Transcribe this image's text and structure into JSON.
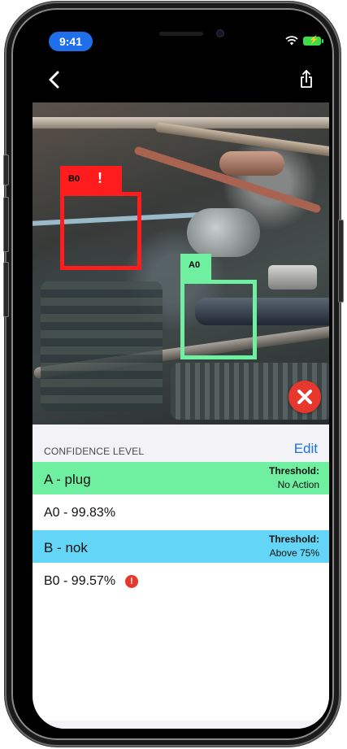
{
  "status_bar": {
    "time": "9:41"
  },
  "detections": [
    {
      "label": "B0",
      "alert": "!",
      "color": "#ff1c1c"
    },
    {
      "label": "A0",
      "color": "#6ef0a0"
    }
  ],
  "confidence": {
    "section_title": "CONFIDENCE LEVEL",
    "edit_label": "Edit",
    "groups": [
      {
        "name": "A - plug",
        "threshold_label": "Threshold:",
        "threshold_value": "No Action",
        "color": "#6ef0a0",
        "item": "A0 - 99.83%"
      },
      {
        "name": "B - nok",
        "threshold_label": "Threshold:",
        "threshold_value": "Above 75%",
        "color": "#63d5f7",
        "item": "B0 - 99.57%",
        "item_alert": "!"
      }
    ]
  },
  "icons": {
    "back": "chevron-left-icon",
    "share": "share-icon",
    "wifi": "wifi-icon",
    "battery": "battery-icon",
    "close": "close-icon"
  },
  "colors": {
    "accent": "#1a73e8",
    "time_pill": "#1f6feb",
    "danger": "#e8382e"
  }
}
